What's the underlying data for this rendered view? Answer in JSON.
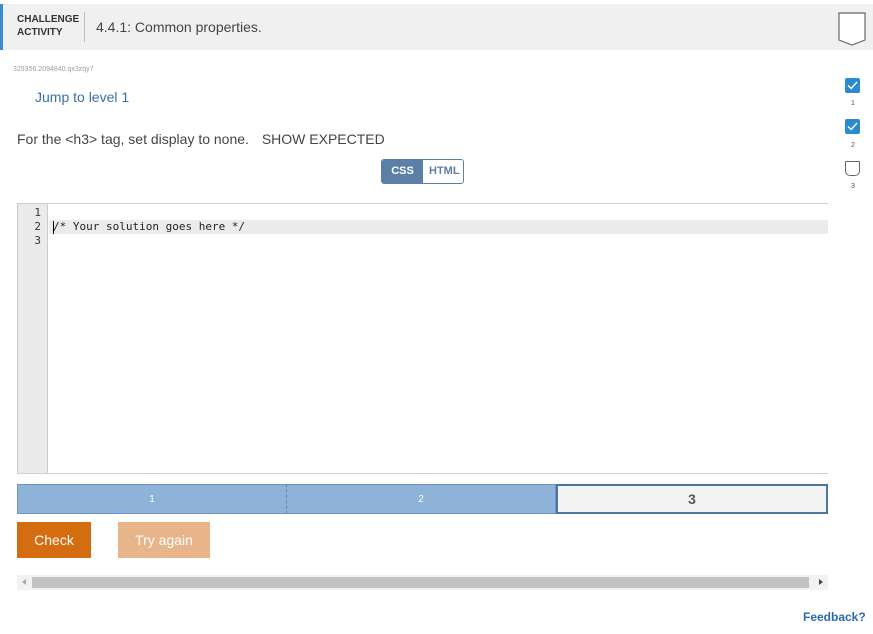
{
  "header": {
    "kind_line1": "CHALLENGE",
    "kind_line2": "ACTIVITY",
    "title": "4.4.1: Common properties."
  },
  "activity_id": "329356.2094840.qx3zqy7",
  "jump_link": "Jump to level 1",
  "progress": [
    {
      "level": "1",
      "done": true
    },
    {
      "level": "2",
      "done": true
    },
    {
      "level": "3",
      "done": false
    }
  ],
  "instructions": {
    "text": "For the <h3> tag, set display to none.",
    "show_expected": "SHOW EXPECTED"
  },
  "toggle": {
    "css": "CSS",
    "html": "HTML",
    "active": "CSS"
  },
  "editor": {
    "line_numbers": [
      "1",
      "2",
      "3"
    ],
    "lines": [
      "",
      "/* Your solution goes here */",
      ""
    ]
  },
  "levels": [
    {
      "label": "1",
      "state": "done"
    },
    {
      "label": "2",
      "state": "done"
    },
    {
      "label": "3",
      "state": "current"
    }
  ],
  "buttons": {
    "check": "Check",
    "try_again": "Try again"
  },
  "feedback": "Feedback?",
  "colors": {
    "accent": "#3a8bd0",
    "check_button": "#d46d10",
    "try_button": "#e8b48a",
    "level_done": "#8fb2d8",
    "link": "#3b6fa3"
  }
}
